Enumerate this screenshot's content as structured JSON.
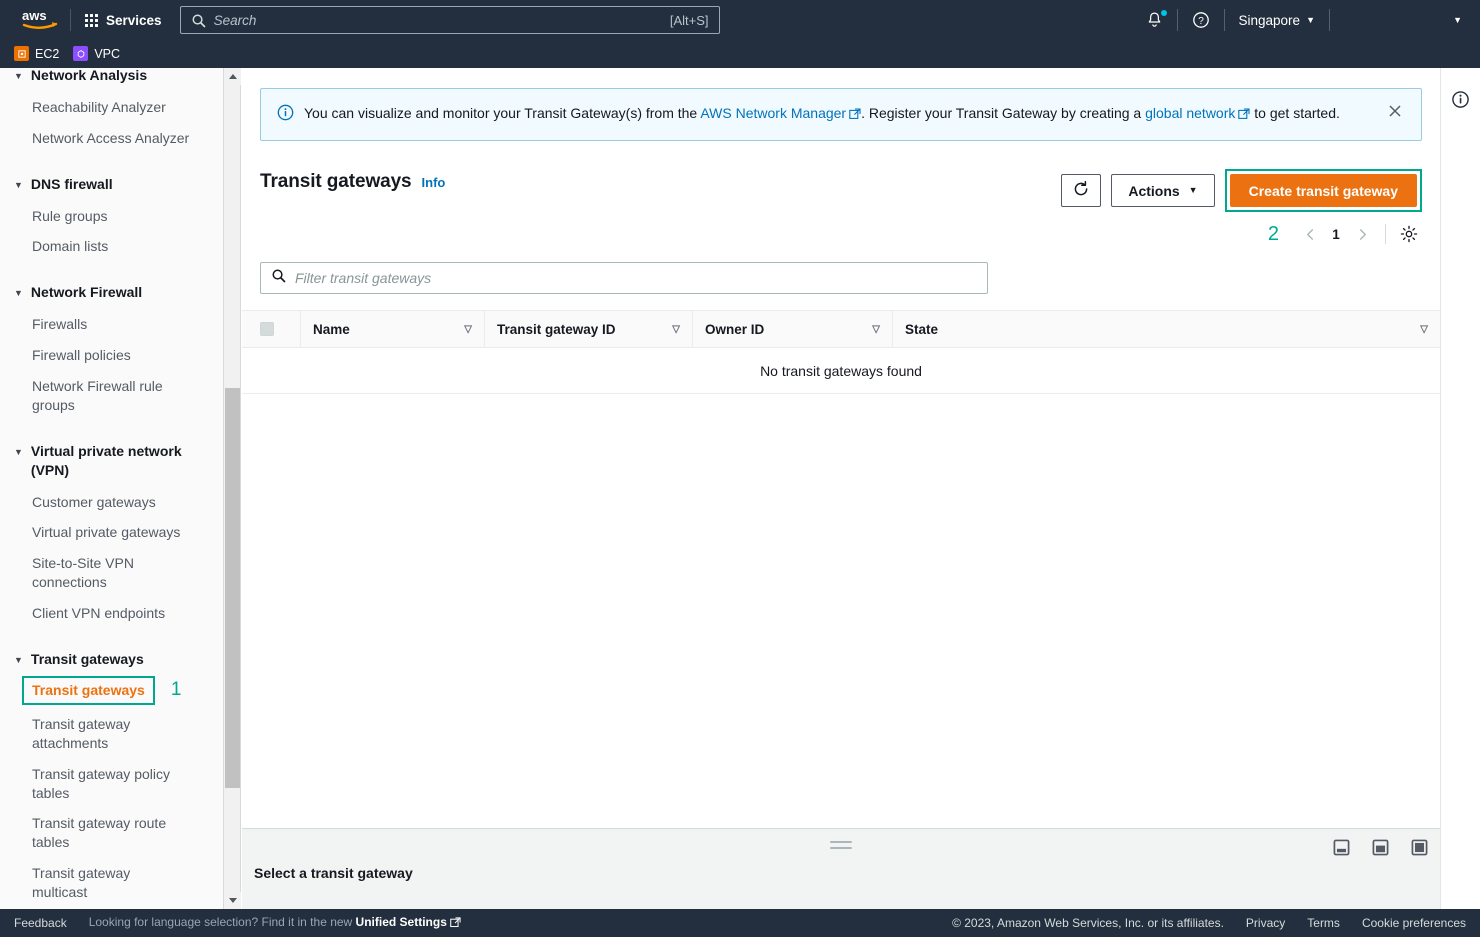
{
  "topnav": {
    "logo": "aws-logo",
    "services_label": "Services",
    "search": {
      "placeholder": "Search",
      "value": "",
      "shortcut": "[Alt+S]"
    },
    "notifications_icon": "bell-icon",
    "help_icon": "help-circle-icon",
    "region": "Singapore",
    "account_label": ""
  },
  "service_tabs": [
    {
      "label": "EC2",
      "icon": "ec2-icon",
      "color": "#ed7100"
    },
    {
      "label": "VPC",
      "icon": "vpc-icon",
      "color": "#8c4fff"
    }
  ],
  "sidebar": {
    "groups": [
      {
        "label": "Network Analysis",
        "clipped": true,
        "items": [
          {
            "label": "Reachability Analyzer"
          },
          {
            "label": "Network Access Analyzer"
          }
        ]
      },
      {
        "label": "DNS firewall",
        "items": [
          {
            "label": "Rule groups"
          },
          {
            "label": "Domain lists"
          }
        ]
      },
      {
        "label": "Network Firewall",
        "items": [
          {
            "label": "Firewalls"
          },
          {
            "label": "Firewall policies"
          },
          {
            "label": "Network Firewall rule groups"
          }
        ]
      },
      {
        "label": "Virtual private network (VPN)",
        "items": [
          {
            "label": "Customer gateways"
          },
          {
            "label": "Virtual private gateways"
          },
          {
            "label": "Site-to-Site VPN connections"
          },
          {
            "label": "Client VPN endpoints"
          }
        ]
      },
      {
        "label": "Transit gateways",
        "items": [
          {
            "label": "Transit gateways",
            "active": true,
            "annotation": "1"
          },
          {
            "label": "Transit gateway attachments"
          },
          {
            "label": "Transit gateway policy tables"
          },
          {
            "label": "Transit gateway route tables"
          },
          {
            "label": "Transit gateway multicast"
          }
        ]
      }
    ]
  },
  "banner": {
    "icon": "info-circle-icon",
    "text_1": "You can visualize and monitor your Transit Gateway(s) from the ",
    "link_1": "AWS Network Manager",
    "text_2": ". Register your Transit Gateway by creating a ",
    "link_2": "global network",
    "text_3": " to get started.",
    "close_icon": "close-icon"
  },
  "toolbar": {
    "title": "Transit gateways",
    "info_label": "Info",
    "refresh_icon": "refresh-icon",
    "actions_label": "Actions",
    "create_label": "Create transit gateway",
    "create_annotation": "2",
    "pagination": {
      "prev_icon": "chevron-left-icon",
      "current_page": "1",
      "next_icon": "chevron-right-icon",
      "settings_icon": "gear-icon"
    }
  },
  "filter": {
    "placeholder": "Filter transit gateways",
    "value": "",
    "icon": "search-icon"
  },
  "table": {
    "columns": [
      {
        "label": "Name"
      },
      {
        "label": "Transit gateway ID"
      },
      {
        "label": "Owner ID"
      },
      {
        "label": "State"
      }
    ],
    "rows": [],
    "empty_message": "No transit gateways found"
  },
  "split_panel": {
    "title": "Select a transit gateway",
    "layout_icons": [
      "split-bottom-small-icon",
      "split-bottom-medium-icon",
      "split-bottom-large-icon"
    ]
  },
  "right_rail": {
    "info_icon": "info-panel-icon"
  },
  "footer": {
    "feedback": "Feedback",
    "lang_prefix": "Looking for language selection? Find it in the new ",
    "lang_link": "Unified Settings",
    "copyright": "© 2023, Amazon Web Services, Inc. or its affiliates.",
    "privacy": "Privacy",
    "terms": "Terms",
    "cookies": "Cookie preferences"
  },
  "colors": {
    "accent_orange": "#ec7211",
    "annotation_teal": "#00a88e",
    "link_blue": "#0073bb",
    "nav_dark": "#232f3e"
  }
}
